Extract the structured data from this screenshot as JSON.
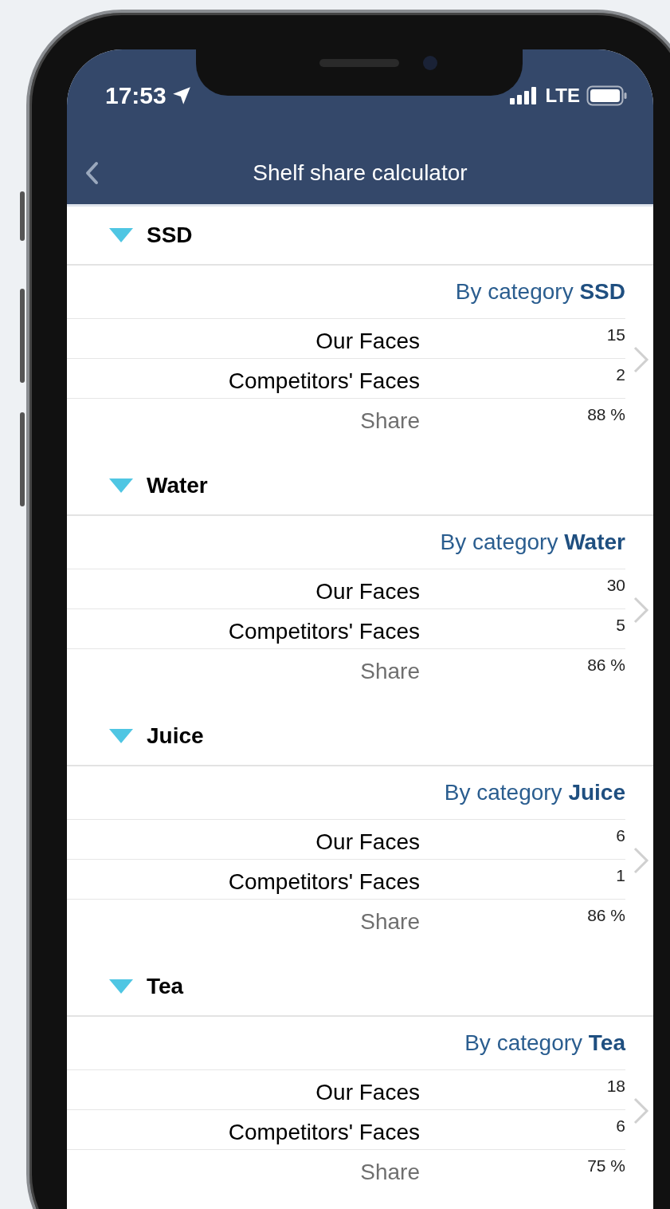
{
  "status_bar": {
    "time": "17:53",
    "network": "LTE"
  },
  "nav": {
    "title": "Shelf share calculator"
  },
  "sections": [
    {
      "name": "SSD",
      "expanded": true,
      "heading": "By category **SSD**",
      "rows": [
        {
          "kind": "count",
          "label": "Our Faces",
          "value": "15"
        },
        {
          "kind": "count",
          "label": "Competitors' Faces",
          "value": "2"
        },
        {
          "kind": "share",
          "label": "Share",
          "value": "88 %"
        }
      ]
    },
    {
      "name": "Water",
      "expanded": true,
      "heading": "By category **Water**",
      "rows": [
        {
          "kind": "count",
          "label": "Our Faces",
          "value": "30"
        },
        {
          "kind": "count",
          "label": "Competitors' Faces",
          "value": "5"
        },
        {
          "kind": "share",
          "label": "Share",
          "value": "86 %"
        }
      ]
    },
    {
      "name": "Juice",
      "expanded": true,
      "heading": "By category **Juice**",
      "rows": [
        {
          "kind": "count",
          "label": "Our Faces",
          "value": "6"
        },
        {
          "kind": "count",
          "label": "Competitors' Faces",
          "value": "1"
        },
        {
          "kind": "share",
          "label": "Share",
          "value": "86 %"
        }
      ]
    },
    {
      "name": "Tea",
      "expanded": true,
      "heading": "By category **Tea**",
      "rows": [
        {
          "kind": "count",
          "label": "Our Faces",
          "value": "18"
        },
        {
          "kind": "count",
          "label": "Competitors' Faces",
          "value": "6"
        },
        {
          "kind": "share",
          "label": "Share",
          "value": "75 %"
        }
      ]
    }
  ]
}
